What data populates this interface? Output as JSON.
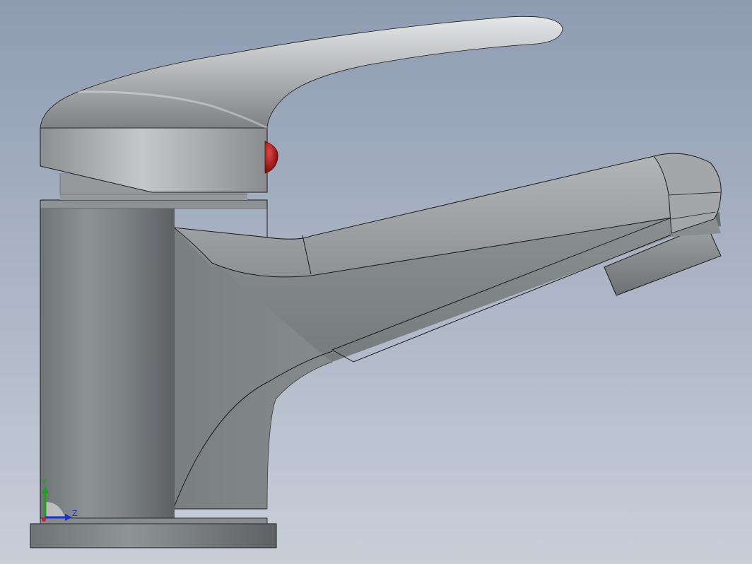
{
  "viewport": {
    "background_top": "#8e9cb2",
    "background_bottom": "#c9ced9"
  },
  "model": {
    "body_color": "#8a8f93",
    "handle_color": "#c2c4c6",
    "indicator_color": "#b01a1a",
    "edge_color": "#1a1a1a"
  },
  "triad": {
    "y_label": "Y",
    "z_label": "Z",
    "y_color": "#1aa31a",
    "z_color": "#1a35cc",
    "x_color": "#cc2222"
  }
}
